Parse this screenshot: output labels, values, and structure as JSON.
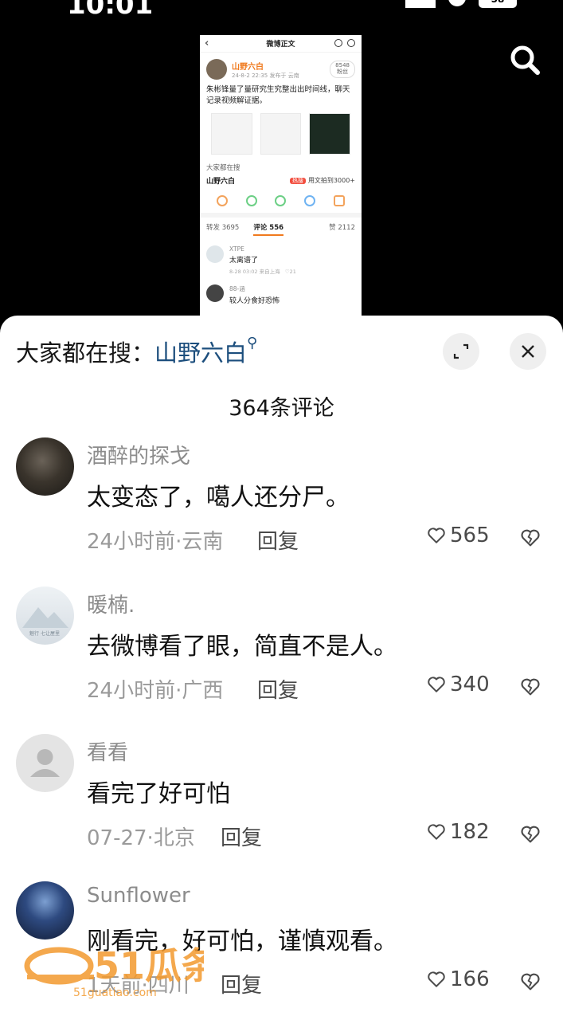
{
  "status": {
    "time": "10:01",
    "battery": "58"
  },
  "thumbnail": {
    "page_title": "微博正文",
    "username": "山野六白",
    "meta": "24-8-2 22:35  发布于 云南",
    "fans": "8548",
    "fans_label": "粉丝",
    "post_text": "朱彬锋量了量研究生究整出出时间线，聊天记录视频解证据。",
    "section_label": "大家都在搜",
    "search_term": "山野六白",
    "hot_tag": "热搜",
    "hot_text": "用文拍到3000+",
    "tab_repost": "转发 3695",
    "tab_comment": "评论 556",
    "tab_like": "赞 2112",
    "comment1_name": "XTPE",
    "comment1_text": "太离谱了",
    "comment1_meta": "8-28 03:02  来自上海",
    "comment1_likes": "21",
    "comment2_name": "88-涵",
    "comment2_text": "较人分食好恐怖"
  },
  "panel": {
    "hot_search_label": "大家都在搜：",
    "hot_search_keyword": "山野六白",
    "title": "364条评论",
    "reply_label": "回复"
  },
  "comments": [
    {
      "name": "酒醉的探戈",
      "text": "太变态了，噶人还分尸。",
      "meta": "24小时前·云南",
      "likes": "565"
    },
    {
      "name": "暖楠.",
      "text": "去微博看了眼，简直不是人。",
      "meta": "24小时前·广西",
      "likes": "340",
      "avatar_caption": "魅行 七让屋里"
    },
    {
      "name": "看看",
      "text": "看完了好可怕",
      "meta": "07-27·北京",
      "likes": "182"
    },
    {
      "name": "Sunflower",
      "text": "刚看完，好可怕，谨慎观看。",
      "meta": "1天前·四川",
      "likes": "166"
    }
  ],
  "watermark": {
    "logo": "51瓜条",
    "url": "51guatiao.com"
  },
  "colors": {
    "keyword": "#1c4e7d",
    "accent_orange": "#f07a1e"
  }
}
